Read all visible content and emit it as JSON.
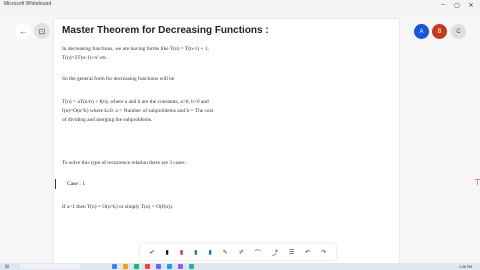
{
  "app": {
    "title": "Microsoft Whiteboard"
  },
  "window_controls": {
    "minimize": "–",
    "maximize": "▢",
    "close": "✕"
  },
  "nav": {
    "back": "←",
    "forward": "⊡"
  },
  "page": {
    "title": "Master Theorem for Decreasing Functions :",
    "para1_line1": "In decreasing functions, we are having forms like T(n) = T(n-1) + 1,",
    "para1_line2": "T(n)=2T(n-1)+n² etc.",
    "para2": "So the general form for decreasing functions will be",
    "para3_line1": "T(n) = aT(n-b) + f(n), where a and b are the constants, a>0, b>0 and",
    "para3_line2": "f(n)=O(n^k) where k≥0. a = Number of subproblems and b = The cost",
    "para3_line3": "of dividing and merging the subproblems.",
    "para4": "To solve this type of recurrence relation there are 3 cases :",
    "case1_label": "Case : 1",
    "case1_text": "If a<1 then T(n) = O(n^k) or simply T(n) = O(f(n))."
  },
  "avatars": [
    {
      "label": "A",
      "color": "#1a56db"
    },
    {
      "label": "B",
      "color": "#c53a1c"
    },
    {
      "label": "C",
      "color": "#dedede"
    }
  ],
  "toolbar": {
    "tools": [
      "✔",
      "▮",
      "▮",
      "▮",
      "▮",
      "✎",
      "✐",
      "⌒",
      "⤴",
      "☰",
      "↶",
      "↷"
    ]
  },
  "tray": {
    "time": "1:36 PM"
  }
}
